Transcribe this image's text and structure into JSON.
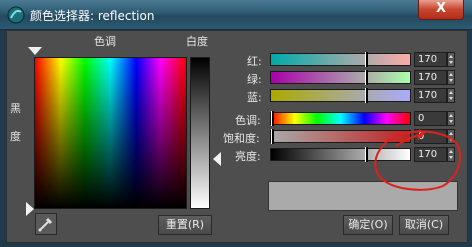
{
  "window": {
    "title": "颜色选择器: reflection",
    "close_label": "X"
  },
  "labels": {
    "hue_top": "色调",
    "whiteness": "白度",
    "blackness": "黑度"
  },
  "buttons": {
    "reset": "重置(R)",
    "ok": "确定(O)",
    "cancel": "取消(C)"
  },
  "rows": [
    {
      "label": "红:",
      "value": "170",
      "position": 0.667
    },
    {
      "label": "绿:",
      "value": "170",
      "position": 0.667
    },
    {
      "label": "蓝:",
      "value": "170",
      "position": 0.667
    },
    {
      "label": "色调:",
      "value": "0",
      "position": 0.0
    },
    {
      "label": "饱和度:",
      "value": "0",
      "position": 0.0
    },
    {
      "label": "亮度:",
      "value": "170",
      "position": 0.667
    }
  ],
  "colors": {
    "current": "#aaaaaa",
    "annotation": "#e0201a"
  },
  "icons": {
    "app": "colorpicker-app-icon",
    "eyedropper": "eyedropper-icon"
  }
}
